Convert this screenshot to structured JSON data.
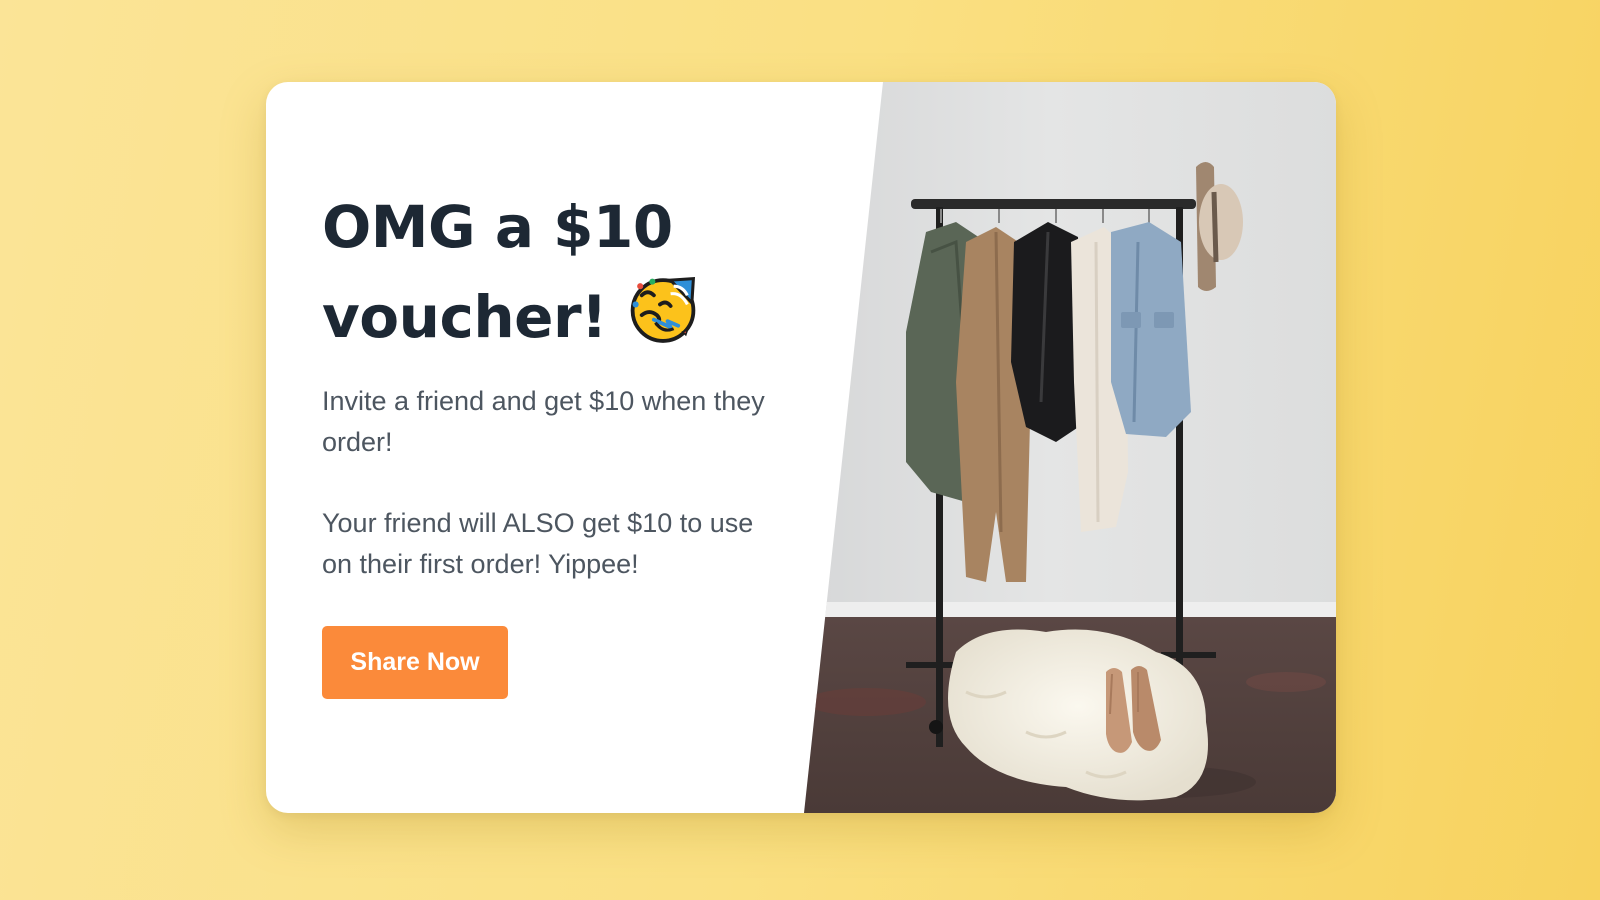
{
  "card": {
    "title": "OMG a $10 voucher!",
    "title_emoji_icon": "party-face-icon",
    "paragraph_1": "Invite a friend and get $10 when they order!",
    "paragraph_2": "Your friend will ALSO get $10 to use on their first order! Yippee!",
    "cta_label": "Share Now",
    "image_subject": "clothing-rack-photo"
  },
  "colors": {
    "background_start": "#fbe497",
    "background_end": "#f7d25e",
    "card": "#ffffff",
    "title": "#1d2834",
    "body_text": "#4d5660",
    "button": "#fb8a3a",
    "button_text": "#ffffff"
  }
}
